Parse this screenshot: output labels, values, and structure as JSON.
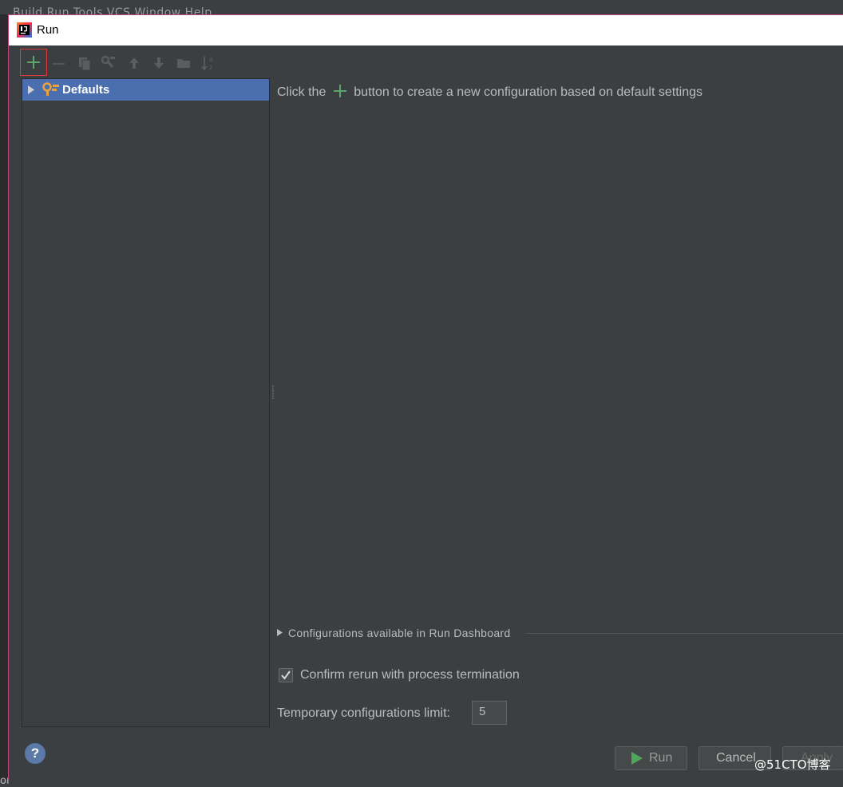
{
  "background_ide": {
    "menu_text": "Build  Run  Tools  VCS  Window  Help",
    "left_edge_text": "or"
  },
  "dialog": {
    "title": "Run",
    "app_icon": "intellij-idea-icon"
  },
  "toolbar": {
    "items": [
      {
        "name": "add",
        "icon": "plus-icon",
        "enabled": true,
        "highlighted": true
      },
      {
        "name": "remove",
        "icon": "minus-icon",
        "enabled": false
      },
      {
        "name": "copy",
        "icon": "copy-icon",
        "enabled": false
      },
      {
        "name": "edit-defaults",
        "icon": "wrench-icon",
        "enabled": false
      },
      {
        "name": "move-up",
        "icon": "arrow-up-icon",
        "enabled": false
      },
      {
        "name": "move-down",
        "icon": "arrow-down-icon",
        "enabled": false
      },
      {
        "name": "folder",
        "icon": "folder-icon",
        "enabled": false
      },
      {
        "name": "sort",
        "icon": "sort-alpha-icon",
        "enabled": false
      }
    ]
  },
  "tree": {
    "items": [
      {
        "label": "Defaults",
        "icon": "wrench-gear-icon",
        "selected": true,
        "expanded": false
      }
    ]
  },
  "main": {
    "hint_prefix": "Click the",
    "hint_suffix": "button to create a new configuration based on default settings",
    "dashboard_label": "Configurations available in Run Dashboard",
    "confirm_rerun_label": "Confirm rerun with process termination",
    "confirm_rerun_checked": true,
    "temp_limit_label": "Temporary configurations limit:",
    "temp_limit_value": "5"
  },
  "buttons": {
    "help": "?",
    "run": "Run",
    "cancel": "Cancel",
    "apply": "Apply"
  },
  "watermark": "@51CTO博客",
  "colors": {
    "background": "#3c3f41",
    "selection": "#4b6eaf",
    "accent_green": "#59a869",
    "highlight_border": "#e03a3a",
    "dialog_border": "#c2437b"
  }
}
